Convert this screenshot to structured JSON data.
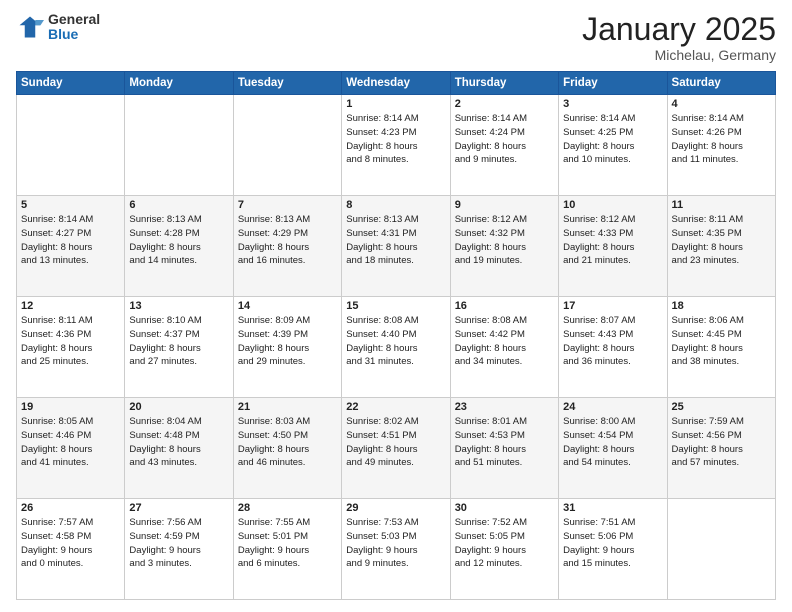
{
  "header": {
    "logo_general": "General",
    "logo_blue": "Blue",
    "month_title": "January 2025",
    "location": "Michelau, Germany"
  },
  "weekdays": [
    "Sunday",
    "Monday",
    "Tuesday",
    "Wednesday",
    "Thursday",
    "Friday",
    "Saturday"
  ],
  "weeks": [
    [
      {
        "day": "",
        "detail": ""
      },
      {
        "day": "",
        "detail": ""
      },
      {
        "day": "",
        "detail": ""
      },
      {
        "day": "1",
        "detail": "Sunrise: 8:14 AM\nSunset: 4:23 PM\nDaylight: 8 hours\nand 8 minutes."
      },
      {
        "day": "2",
        "detail": "Sunrise: 8:14 AM\nSunset: 4:24 PM\nDaylight: 8 hours\nand 9 minutes."
      },
      {
        "day": "3",
        "detail": "Sunrise: 8:14 AM\nSunset: 4:25 PM\nDaylight: 8 hours\nand 10 minutes."
      },
      {
        "day": "4",
        "detail": "Sunrise: 8:14 AM\nSunset: 4:26 PM\nDaylight: 8 hours\nand 11 minutes."
      }
    ],
    [
      {
        "day": "5",
        "detail": "Sunrise: 8:14 AM\nSunset: 4:27 PM\nDaylight: 8 hours\nand 13 minutes."
      },
      {
        "day": "6",
        "detail": "Sunrise: 8:13 AM\nSunset: 4:28 PM\nDaylight: 8 hours\nand 14 minutes."
      },
      {
        "day": "7",
        "detail": "Sunrise: 8:13 AM\nSunset: 4:29 PM\nDaylight: 8 hours\nand 16 minutes."
      },
      {
        "day": "8",
        "detail": "Sunrise: 8:13 AM\nSunset: 4:31 PM\nDaylight: 8 hours\nand 18 minutes."
      },
      {
        "day": "9",
        "detail": "Sunrise: 8:12 AM\nSunset: 4:32 PM\nDaylight: 8 hours\nand 19 minutes."
      },
      {
        "day": "10",
        "detail": "Sunrise: 8:12 AM\nSunset: 4:33 PM\nDaylight: 8 hours\nand 21 minutes."
      },
      {
        "day": "11",
        "detail": "Sunrise: 8:11 AM\nSunset: 4:35 PM\nDaylight: 8 hours\nand 23 minutes."
      }
    ],
    [
      {
        "day": "12",
        "detail": "Sunrise: 8:11 AM\nSunset: 4:36 PM\nDaylight: 8 hours\nand 25 minutes."
      },
      {
        "day": "13",
        "detail": "Sunrise: 8:10 AM\nSunset: 4:37 PM\nDaylight: 8 hours\nand 27 minutes."
      },
      {
        "day": "14",
        "detail": "Sunrise: 8:09 AM\nSunset: 4:39 PM\nDaylight: 8 hours\nand 29 minutes."
      },
      {
        "day": "15",
        "detail": "Sunrise: 8:08 AM\nSunset: 4:40 PM\nDaylight: 8 hours\nand 31 minutes."
      },
      {
        "day": "16",
        "detail": "Sunrise: 8:08 AM\nSunset: 4:42 PM\nDaylight: 8 hours\nand 34 minutes."
      },
      {
        "day": "17",
        "detail": "Sunrise: 8:07 AM\nSunset: 4:43 PM\nDaylight: 8 hours\nand 36 minutes."
      },
      {
        "day": "18",
        "detail": "Sunrise: 8:06 AM\nSunset: 4:45 PM\nDaylight: 8 hours\nand 38 minutes."
      }
    ],
    [
      {
        "day": "19",
        "detail": "Sunrise: 8:05 AM\nSunset: 4:46 PM\nDaylight: 8 hours\nand 41 minutes."
      },
      {
        "day": "20",
        "detail": "Sunrise: 8:04 AM\nSunset: 4:48 PM\nDaylight: 8 hours\nand 43 minutes."
      },
      {
        "day": "21",
        "detail": "Sunrise: 8:03 AM\nSunset: 4:50 PM\nDaylight: 8 hours\nand 46 minutes."
      },
      {
        "day": "22",
        "detail": "Sunrise: 8:02 AM\nSunset: 4:51 PM\nDaylight: 8 hours\nand 49 minutes."
      },
      {
        "day": "23",
        "detail": "Sunrise: 8:01 AM\nSunset: 4:53 PM\nDaylight: 8 hours\nand 51 minutes."
      },
      {
        "day": "24",
        "detail": "Sunrise: 8:00 AM\nSunset: 4:54 PM\nDaylight: 8 hours\nand 54 minutes."
      },
      {
        "day": "25",
        "detail": "Sunrise: 7:59 AM\nSunset: 4:56 PM\nDaylight: 8 hours\nand 57 minutes."
      }
    ],
    [
      {
        "day": "26",
        "detail": "Sunrise: 7:57 AM\nSunset: 4:58 PM\nDaylight: 9 hours\nand 0 minutes."
      },
      {
        "day": "27",
        "detail": "Sunrise: 7:56 AM\nSunset: 4:59 PM\nDaylight: 9 hours\nand 3 minutes."
      },
      {
        "day": "28",
        "detail": "Sunrise: 7:55 AM\nSunset: 5:01 PM\nDaylight: 9 hours\nand 6 minutes."
      },
      {
        "day": "29",
        "detail": "Sunrise: 7:53 AM\nSunset: 5:03 PM\nDaylight: 9 hours\nand 9 minutes."
      },
      {
        "day": "30",
        "detail": "Sunrise: 7:52 AM\nSunset: 5:05 PM\nDaylight: 9 hours\nand 12 minutes."
      },
      {
        "day": "31",
        "detail": "Sunrise: 7:51 AM\nSunset: 5:06 PM\nDaylight: 9 hours\nand 15 minutes."
      },
      {
        "day": "",
        "detail": ""
      }
    ]
  ]
}
